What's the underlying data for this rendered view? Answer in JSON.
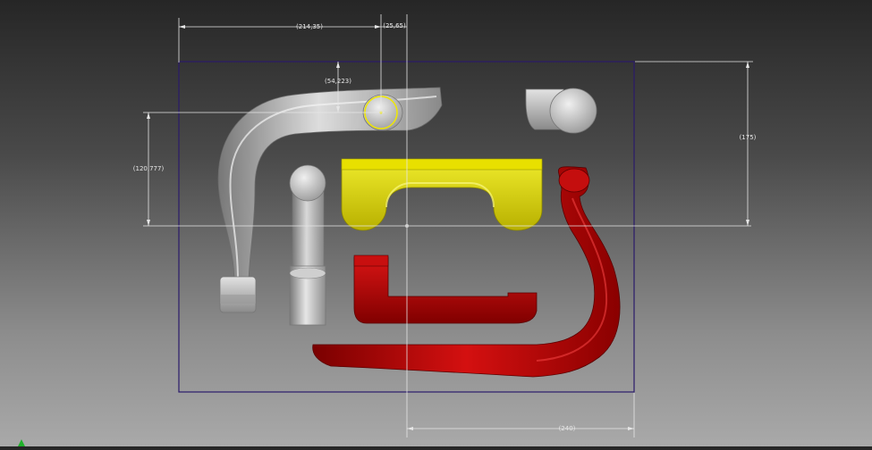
{
  "viewport": {
    "background_top": "#262626",
    "background_bottom": "#a9a9a9",
    "sketch_boundary_color": "#2a1a6a"
  },
  "dimensions": {
    "top_width": "(214,35)",
    "top_offset": "(25,65)",
    "circle_height": "(54,223)",
    "left_height": "(120,777)",
    "right_height": "(175)",
    "bottom_width": "(240)"
  },
  "parts": [
    {
      "name": "gray-handle-lever",
      "color": "#bdbdbd"
    },
    {
      "name": "gray-cylinder-cap",
      "color": "#bdbdbd"
    },
    {
      "name": "gray-pin-post",
      "color": "#bdbdbd"
    },
    {
      "name": "yellow-bracket",
      "color": "#d8d200"
    },
    {
      "name": "red-l-rod",
      "color": "#b00000"
    },
    {
      "name": "red-long-lever",
      "color": "#b00000"
    }
  ],
  "axis_indicator": {
    "color": "#1fb12a"
  }
}
